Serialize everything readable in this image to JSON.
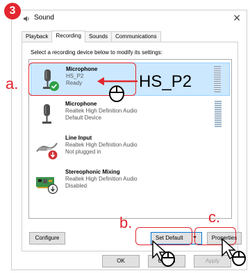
{
  "step_badge": "3",
  "window": {
    "title": "Sound",
    "close_glyph": "×"
  },
  "tabs": [
    {
      "label": "Playback",
      "active": false
    },
    {
      "label": "Recording",
      "active": true
    },
    {
      "label": "Sounds",
      "active": false
    },
    {
      "label": "Communications",
      "active": false
    }
  ],
  "instruction": "Select a recording device below to modify its settings:",
  "devices": [
    {
      "name": "Microphone",
      "line1": "HS_P2",
      "line2": "Ready",
      "icon": "microphone-icon",
      "status": "default-check",
      "selected": true
    },
    {
      "name": "Microphone",
      "line1": "Realtek High Definition Audio",
      "line2": "Default Device",
      "icon": "microphone-icon",
      "status": "none",
      "selected": false
    },
    {
      "name": "Line Input",
      "line1": "Realtek High Definition Audio",
      "line2": "Not plugged in",
      "icon": "line-input-icon",
      "status": "unplugged",
      "selected": false
    },
    {
      "name": "Stereophonic Mixing",
      "line1": "Realtek High Definition Audio",
      "line2": "Disabled",
      "icon": "sound-card-icon",
      "status": "disabled",
      "selected": false
    }
  ],
  "buttons": {
    "configure": "Configure",
    "set_default": "Set Default",
    "set_default_arrow": "▼",
    "properties": "Properties",
    "ok": "OK",
    "cancel": "Cancel",
    "apply": "Apply"
  },
  "annotations": {
    "a_letter": "a.",
    "b_letter": "b.",
    "c_letter": "c.",
    "device_callout": "HS_P2"
  },
  "colors": {
    "annotation_red": "#e3262f",
    "selection_bg": "#cce8ff",
    "default_check_green": "#2ea043",
    "unplugged_red": "#d13438"
  }
}
